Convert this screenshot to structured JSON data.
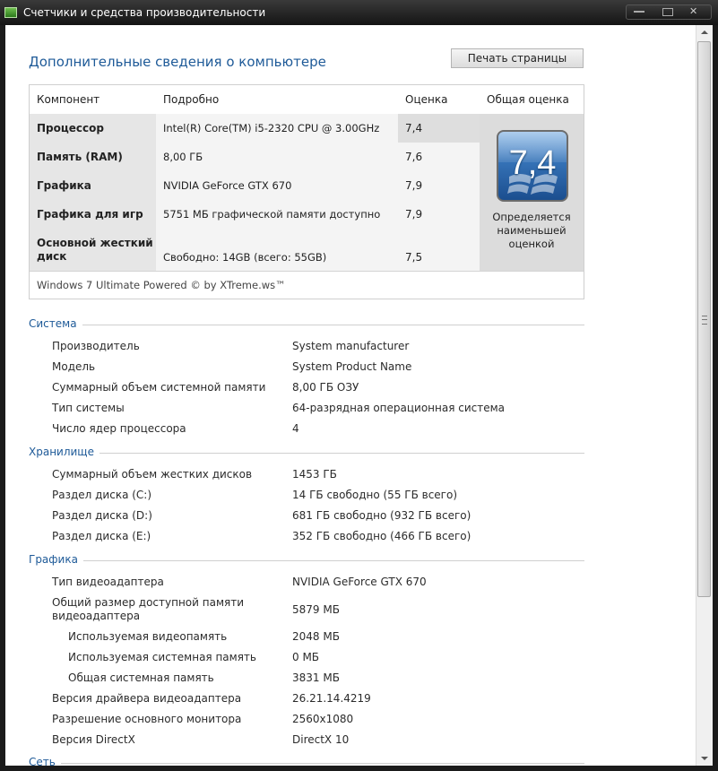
{
  "window": {
    "title": "Счетчики и средства производительности"
  },
  "page": {
    "title": "Дополнительные сведения о компьютере",
    "print_button": "Печать страницы"
  },
  "scores": {
    "headers": {
      "component": "Компонент",
      "details": "Подробно",
      "score": "Оценка",
      "overall": "Общая оценка"
    },
    "rows": [
      {
        "component": "Процессор",
        "details": "Intel(R) Core(TM) i5-2320 CPU @ 3.00GHz",
        "score": "7,4"
      },
      {
        "component": "Память (RAM)",
        "details": "8,00 ГБ",
        "score": "7,6"
      },
      {
        "component": "Графика",
        "details": "NVIDIA GeForce GTX 670",
        "score": "7,9"
      },
      {
        "component": "Графика для игр",
        "details": "5751 МБ графической памяти доступно",
        "score": "7,9"
      },
      {
        "component": "Основной жесткий диск",
        "details": "Свободно: 14GB (всего: 55GB)",
        "score": "7,5"
      }
    ],
    "overall_score": "7,4",
    "overall_note": "Определяется наименьшей оценкой",
    "footer": "Windows 7 Ultimate Powered © by XTreme.ws™"
  },
  "system": {
    "title": "Система",
    "items": [
      {
        "key": "Производитель",
        "value": "System manufacturer"
      },
      {
        "key": "Модель",
        "value": "System Product Name"
      },
      {
        "key": "Суммарный объем системной памяти",
        "value": "8,00 ГБ ОЗУ"
      },
      {
        "key": "Тип системы",
        "value": "64-разрядная операционная система"
      },
      {
        "key": "Число ядер процессора",
        "value": "4"
      }
    ]
  },
  "storage": {
    "title": "Хранилище",
    "items": [
      {
        "key": "Суммарный объем жестких дисков",
        "value": "1453 ГБ"
      },
      {
        "key": "Раздел диска (C:)",
        "value": "14 ГБ свободно (55 ГБ всего)"
      },
      {
        "key": "Раздел диска (D:)",
        "value": "681 ГБ свободно (932 ГБ всего)"
      },
      {
        "key": "Раздел диска (E:)",
        "value": "352 ГБ свободно (466 ГБ всего)"
      }
    ]
  },
  "graphics": {
    "title": "Графика",
    "items": [
      {
        "key": "Тип видеоадаптера",
        "value": "NVIDIA GeForce GTX 670"
      },
      {
        "key": "Общий размер доступной памяти видеоадаптера",
        "value": "5879 МБ"
      },
      {
        "key": "Используемая видеопамять",
        "value": "2048 МБ"
      },
      {
        "key": "Используемая системная память",
        "value": "0 МБ"
      },
      {
        "key": "Общая системная память",
        "value": "3831 МБ"
      },
      {
        "key": "Версия драйвера видеоадаптера",
        "value": "26.21.14.4219"
      },
      {
        "key": "Разрешение основного монитора",
        "value": "2560x1080"
      },
      {
        "key": "Версия DirectX",
        "value": "DirectX 10"
      }
    ]
  },
  "network": {
    "title": "Сеть"
  }
}
